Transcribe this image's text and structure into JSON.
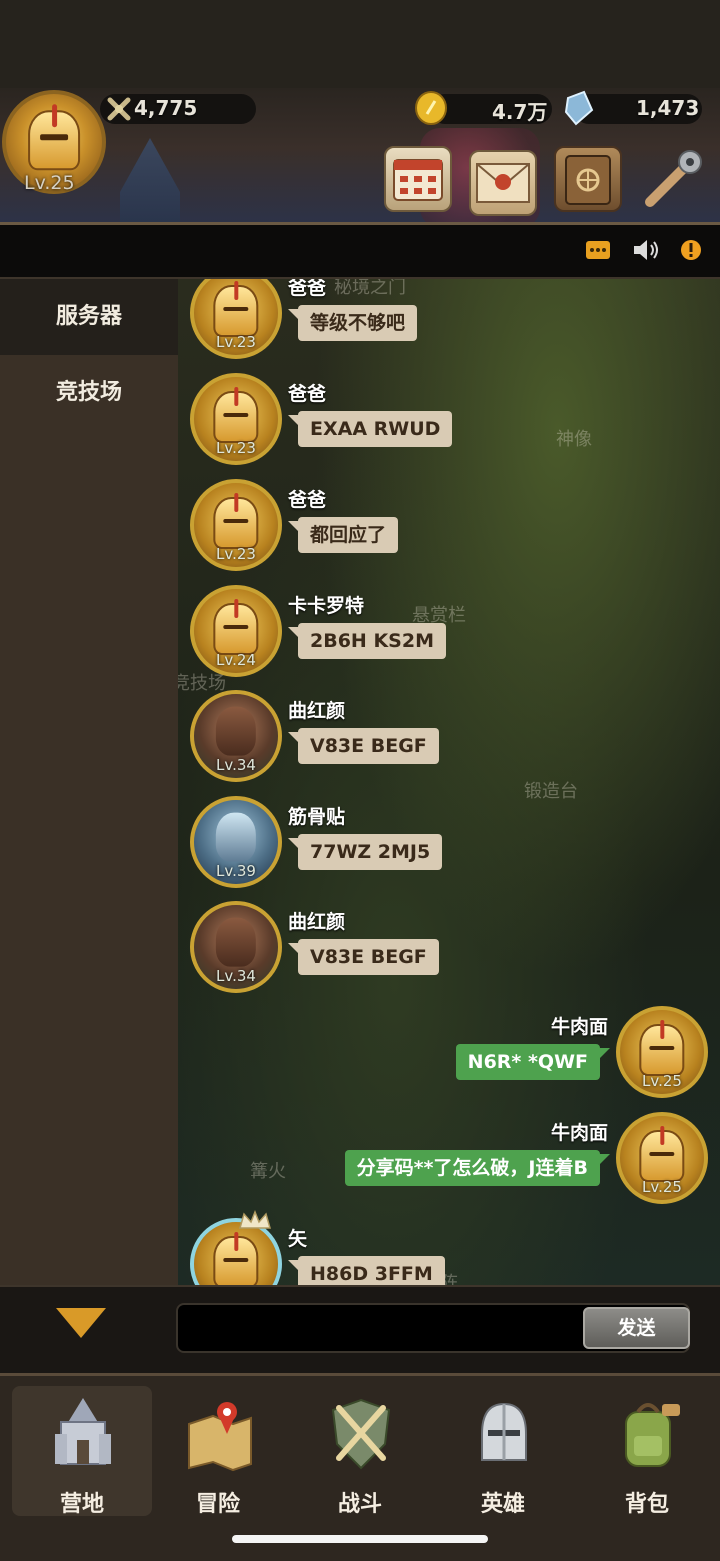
{
  "header": {
    "level": "Lv.25",
    "power": "4,775",
    "gold": "4.7万",
    "gems": "1,473"
  },
  "hud_buttons": [
    "calendar-icon",
    "mail-icon",
    "quest-book-icon",
    "settings-wrench-icon"
  ],
  "status_icons": [
    "more-icon",
    "speaker-icon",
    "alert-icon"
  ],
  "sidebar": {
    "items": [
      {
        "label": "服务器",
        "active": true
      },
      {
        "label": "竞技场",
        "active": false
      }
    ]
  },
  "background_labels": [
    "秘境之门",
    "神像",
    "悬赏栏",
    "竞技场",
    "锻造台",
    "篝火",
    "传送阵"
  ],
  "messages": [
    {
      "side": "left",
      "name": "爸爸",
      "text": "等级不够吧",
      "level": "Lv.23",
      "avatar": "knight"
    },
    {
      "side": "left",
      "name": "爸爸",
      "text": "EXAA RWUD",
      "level": "Lv.23",
      "avatar": "knight"
    },
    {
      "side": "left",
      "name": "爸爸",
      "text": "都回应了",
      "level": "Lv.23",
      "avatar": "knight"
    },
    {
      "side": "left",
      "name": "卡卡罗特",
      "text": "2B6H KS2M",
      "level": "Lv.24",
      "avatar": "knight"
    },
    {
      "side": "left",
      "name": "曲红颜",
      "text": "V83E BEGF",
      "level": "Lv.34",
      "avatar": "warrior"
    },
    {
      "side": "left",
      "name": "筋骨贴",
      "text": "77WZ 2MJ5",
      "level": "Lv.39",
      "avatar": "armored"
    },
    {
      "side": "left",
      "name": "曲红颜",
      "text": "V83E BEGF",
      "level": "Lv.34",
      "avatar": "warrior"
    },
    {
      "side": "right",
      "name": "牛肉面",
      "text": "N6R* *QWF",
      "level": "Lv.25",
      "avatar": "knight"
    },
    {
      "side": "right",
      "name": "牛肉面",
      "text": "分享码**了怎么破，J连着B",
      "level": "Lv.25",
      "avatar": "knight"
    },
    {
      "side": "left",
      "name": "矢",
      "text": "H86D 3FFM",
      "level": "",
      "avatar": "knight-crown"
    }
  ],
  "input": {
    "value": "",
    "send_label": "发送"
  },
  "tabs": [
    {
      "label": "营地",
      "icon": "camp-castle-icon",
      "active": true
    },
    {
      "label": "冒险",
      "icon": "adventure-map-icon",
      "active": false
    },
    {
      "label": "战斗",
      "icon": "battle-shield-icon",
      "active": false
    },
    {
      "label": "英雄",
      "icon": "hero-helmet-icon",
      "active": false
    },
    {
      "label": "背包",
      "icon": "backpack-icon",
      "active": false
    }
  ],
  "colors": {
    "accent_gold": "#d99a28",
    "self_bubble": "#4ea24e",
    "other_bubble": "#d9cbb4",
    "alert": "#f0a020"
  }
}
